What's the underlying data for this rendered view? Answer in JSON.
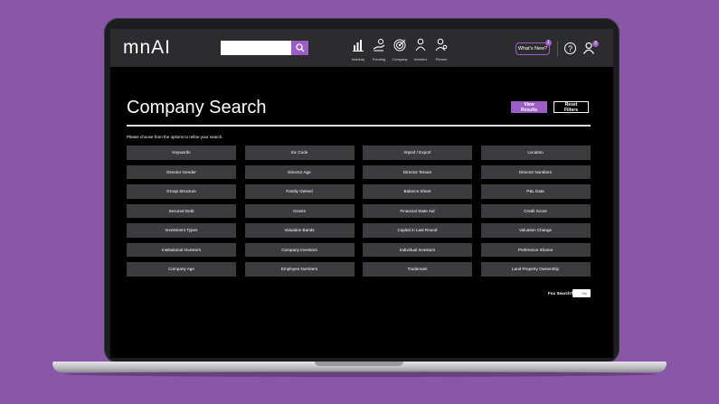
{
  "app": {
    "logo": "mnAI"
  },
  "search": {
    "placeholder": "",
    "value": ""
  },
  "nav": [
    {
      "label": "Industry",
      "icon": "industry-chart-icon"
    },
    {
      "label": "Funding",
      "icon": "funding-hand-icon"
    },
    {
      "label": "Company",
      "icon": "company-target-icon"
    },
    {
      "label": "Investor",
      "icon": "investor-icon"
    },
    {
      "label": "Person",
      "icon": "person-search-icon"
    }
  ],
  "header": {
    "whats_new_label": "What's New?",
    "whats_new_badge": "1",
    "user_badge": "3"
  },
  "page": {
    "title": "Company Search",
    "view_results_label": "View Results",
    "reset_filters_label": "Reset Filters",
    "instructions": "Please choose from the options to refine your search."
  },
  "filters": [
    "Keywords",
    "Sic Code",
    "Import / Export",
    "Location",
    "Director Gender",
    "Director Age",
    "Director Tenure",
    "Director Numbers",
    "Group Structure",
    "Family Owned",
    "Balance Sheet",
    "P&L Data",
    "Secured Debt",
    "Grants",
    "Financial State Aid",
    "Credit Score",
    "Investment Types",
    "Valuation Bands",
    "Capital in Last Round",
    "Valuation Change",
    "Institutional Investors",
    "Company Investors",
    "Individual Investors",
    "Preference Shares",
    "Company Age",
    "Employee Numbers",
    "Trademark",
    "Land Property Ownership"
  ],
  "fox_search": {
    "label": "Fox Search?",
    "value": "No"
  },
  "colors": {
    "accent": "#9b5ec5",
    "background": "#8a57a8",
    "tile": "#3c3c3e"
  }
}
